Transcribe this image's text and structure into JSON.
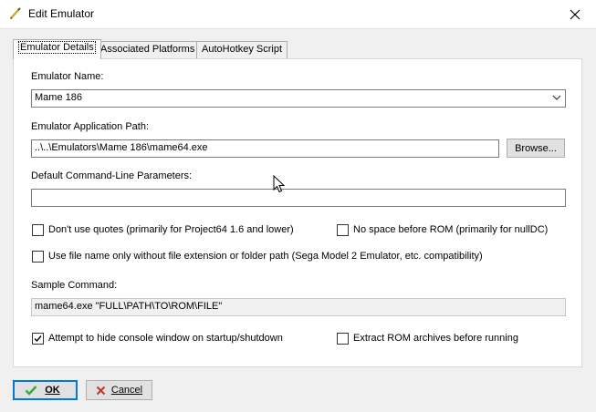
{
  "window": {
    "title": "Edit Emulator",
    "title_icon": "pencil-icon",
    "close_icon": "close-icon"
  },
  "tabs": [
    {
      "label": "Emulator Details",
      "active": true
    },
    {
      "label": "Associated Platforms",
      "active": false
    },
    {
      "label": "AutoHotkey Script",
      "active": false
    }
  ],
  "details": {
    "emulator_name_label": "Emulator Name:",
    "emulator_name_value": "Mame 186",
    "app_path_label": "Emulator Application Path:",
    "app_path_value": "..\\..\\Emulators\\Mame 186\\mame64.exe",
    "browse_label": "Browse...",
    "cmdline_label": "Default Command-Line Parameters:",
    "cmdline_value": "",
    "checkboxes": {
      "dont_use_quotes": {
        "label": "Don't use quotes (primarily for Project64 1.6 and lower)",
        "checked": false
      },
      "no_space_before_rom": {
        "label": "No space before ROM (primarily for nullDC)",
        "checked": false
      },
      "use_file_name_only": {
        "label": "Use file name only without file extension or folder path (Sega Model 2 Emulator, etc. compatibility)",
        "checked": false
      },
      "hide_console": {
        "label": "Attempt to hide console window on startup/shutdown",
        "checked": true
      },
      "extract_rom": {
        "label": "Extract ROM archives before running",
        "checked": false
      }
    },
    "sample_command_label": "Sample Command:",
    "sample_command_value": "mame64.exe \"FULL\\PATH\\TO\\ROM\\FILE\""
  },
  "footer": {
    "ok_label": "OK",
    "cancel_label": "Cancel"
  },
  "colors": {
    "ok_check": "#3aa935",
    "cancel_x": "#c0392b",
    "focus_border": "#0078d7"
  }
}
